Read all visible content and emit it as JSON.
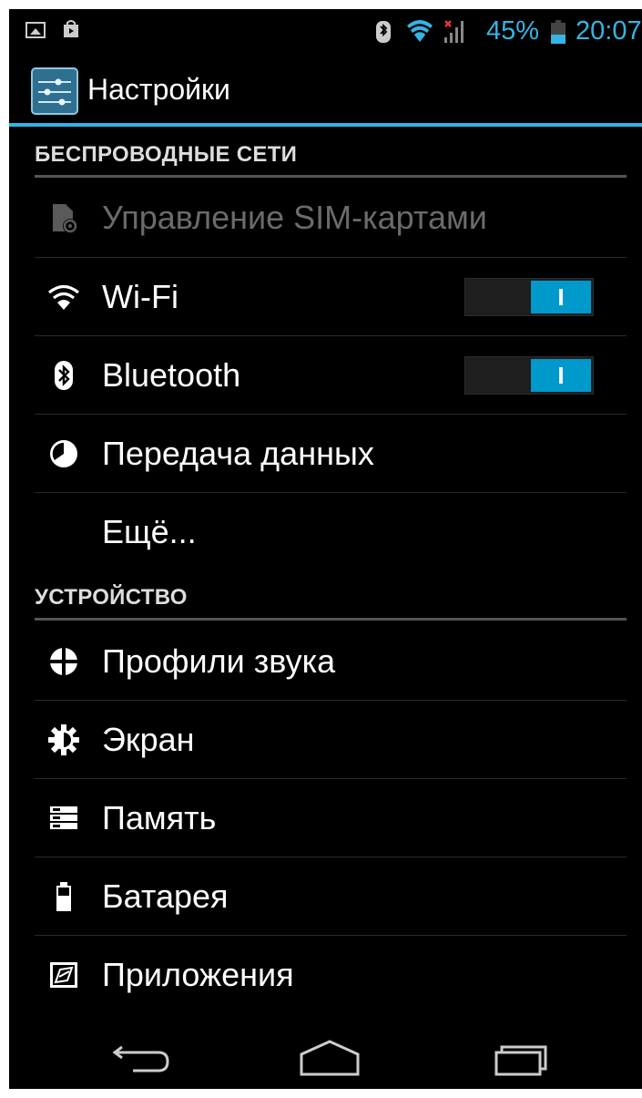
{
  "status_bar": {
    "battery_percent": "45%",
    "battery_level": 0.45,
    "time": "20:07",
    "accent_color": "#33b5e5",
    "icons": [
      "gallery-icon",
      "store-icon",
      "bluetooth-icon",
      "wifi-icon",
      "signal-no-data-icon",
      "battery-icon"
    ]
  },
  "header": {
    "title": "Настройки",
    "app_icon": "settings-sliders-icon"
  },
  "sections": {
    "wireless": {
      "title": "БЕСПРОВОДНЫЕ СЕТИ",
      "items": [
        {
          "label": "Управление SIM-картами",
          "icon": "sim-card-icon",
          "enabled": false
        },
        {
          "label": "Wi-Fi",
          "icon": "wifi-icon",
          "toggle": "I",
          "toggle_on": true
        },
        {
          "label": "Bluetooth",
          "icon": "bluetooth-icon",
          "toggle": "I",
          "toggle_on": true
        },
        {
          "label": "Передача данных",
          "icon": "data-usage-icon"
        },
        {
          "label": "Ещё..."
        }
      ]
    },
    "device": {
      "title": "УСТРОЙСТВО",
      "items": [
        {
          "label": "Профили звука",
          "icon": "sound-profile-icon"
        },
        {
          "label": "Экран",
          "icon": "display-brightness-icon"
        },
        {
          "label": "Память",
          "icon": "storage-icon"
        },
        {
          "label": "Батарея",
          "icon": "battery-icon"
        },
        {
          "label": "Приложения",
          "icon": "apps-icon"
        }
      ]
    }
  },
  "navigation": {
    "buttons": [
      "back-icon",
      "home-icon",
      "recent-apps-icon"
    ]
  },
  "colors": {
    "accent": "#33b5e5",
    "toggle_on": "#0099cc",
    "background": "#000000"
  }
}
